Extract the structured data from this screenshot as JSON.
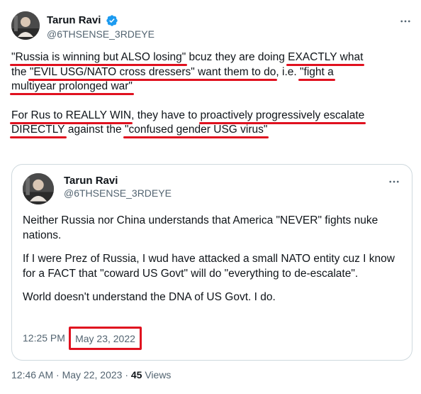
{
  "main_tweet": {
    "author": {
      "name": "Tarun Ravi",
      "handle": "@6THSENSE_3RDEYE",
      "verified": true,
      "avatar_icon": "profile-photo"
    },
    "paragraph1": {
      "seg1": "\"Russia is winning but ALSO losing\"",
      "seg2": " bcuz they are doing ",
      "seg3": "EXACTLY what",
      "seg4": "the ",
      "seg5": "\"EVIL USG/NATO cross dressers\" want them to do",
      "seg6": ", i.e. ",
      "seg7": "\"fight a",
      "seg8": "multiyear prolonged war\""
    },
    "paragraph2": {
      "seg1": "For Rus to REALLY WIN",
      "seg2": ", they have to ",
      "seg3": "proactively progressively escalate",
      "seg4": "DIRECTLY",
      "seg5": " against the ",
      "seg6": "\"confused gender USG virus\""
    },
    "meta": {
      "time_date": "12:46 AM · May 22, 2023 · ",
      "views_count": "45",
      "views_label": " Views"
    }
  },
  "quoted_tweet": {
    "author": {
      "name": "Tarun Ravi",
      "handle": "@6THSENSE_3RDEYE",
      "avatar_icon": "profile-photo"
    },
    "paragraphs": [
      "Neither Russia nor China understands that America \"NEVER\" fights nuke nations.",
      "If I were Prez of Russia, I wud have attacked a small NATO entity cuz I know for a FACT that \"coward US Govt\" will do \"everything to de-escalate\".",
      "World doesn't understand the DNA of US Govt. I do."
    ],
    "time": "12:25 PM",
    "date": "May 23, 2022"
  },
  "colors": {
    "highlight": "#e0111f",
    "verified": "#1d9bf0",
    "muted_text": "#536471",
    "text": "#0f1419",
    "border": "#cfd9de"
  },
  "icons": {
    "verified": "verified-badge-icon",
    "more": "more-options-icon"
  }
}
